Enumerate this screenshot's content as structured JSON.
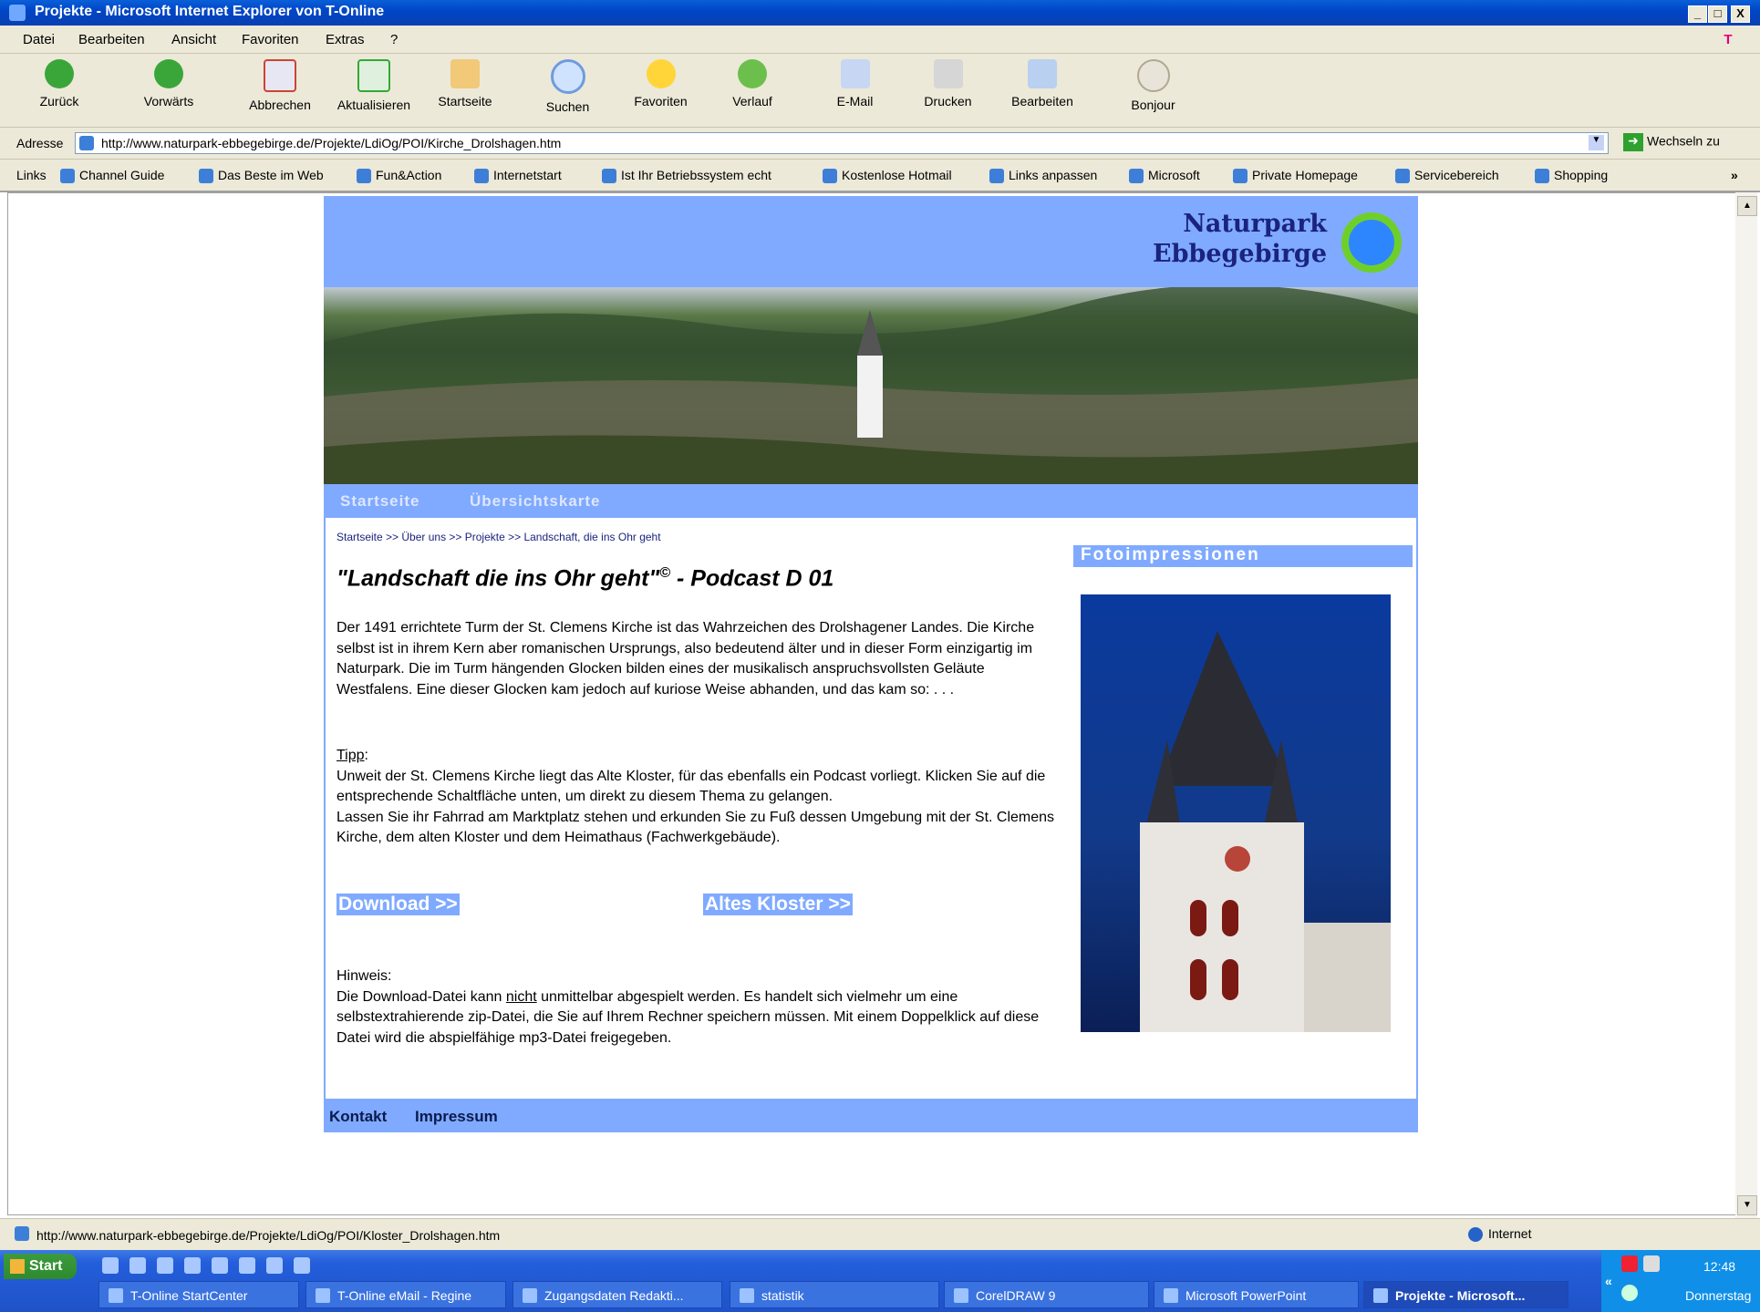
{
  "window": {
    "title": "Projekte - Microsoft Internet Explorer von T-Online",
    "minimize": "_",
    "maximize": "□",
    "close": "X"
  },
  "menu": [
    "Datei",
    "Bearbeiten",
    "Ansicht",
    "Favoriten",
    "Extras",
    "?"
  ],
  "brand_logo": "T",
  "toolbar": [
    {
      "label": "Zurück",
      "icon": "back-arrow-icon"
    },
    {
      "label": "Vorwärts",
      "icon": "forward-arrow-icon"
    },
    {
      "label": "Abbrechen",
      "icon": "stop-icon"
    },
    {
      "label": "Aktualisieren",
      "icon": "refresh-icon"
    },
    {
      "label": "Startseite",
      "icon": "home-icon"
    },
    {
      "label": "Suchen",
      "icon": "search-icon"
    },
    {
      "label": "Favoriten",
      "icon": "star-icon"
    },
    {
      "label": "Verlauf",
      "icon": "history-icon"
    },
    {
      "label": "E-Mail",
      "icon": "mail-icon"
    },
    {
      "label": "Drucken",
      "icon": "printer-icon"
    },
    {
      "label": "Bearbeiten",
      "icon": "edit-icon"
    },
    {
      "label": "Bonjour",
      "icon": "bonjour-icon"
    }
  ],
  "address": {
    "label": "Adresse",
    "url": "http://www.naturpark-ebbegebirge.de/Projekte/LdiOg/POI/Kirche_Drolshagen.htm",
    "go": "Wechseln zu"
  },
  "links": {
    "label": "Links",
    "items": [
      "Channel Guide",
      "Das Beste im Web",
      "Fun&Action",
      "Internetstart",
      "Ist Ihr Betriebssystem echt",
      "Kostenlose Hotmail",
      "Links anpassen",
      "Microsoft",
      "Private Homepage",
      "Servicebereich",
      "Shopping"
    ],
    "more": "»"
  },
  "page": {
    "logo_line1": "Naturpark",
    "logo_line2": "Ebbegebirge",
    "nav": [
      "Startseite",
      "Übersichtskarte"
    ],
    "breadcrumb": "Startseite >> Über uns >> Projekte >> Landschaft, die ins Ohr geht",
    "heading": "\"Landschaft die ins Ohr geht\"",
    "heading_sup": "©",
    "heading_rest": " -  Podcast D 01",
    "intro": "Der 1491 errichtete Turm der St. Clemens Kirche ist das Wahrzeichen des Drolshagener Landes. Die Kirche selbst ist in ihrem Kern aber romanischen Ursprungs, also bedeutend älter und in dieser Form einzigartig im Naturpark. Die im Turm hängenden Glocken bilden eines der musikalisch anspruchsvollsten Geläute Westfalens. Eine dieser Glocken kam jedoch auf kuriose Weise abhanden, und das kam so: . . .",
    "tipp_label": "Tipp",
    "tipp_colon": ":",
    "tipp_text1": "Unweit der St. Clemens Kirche liegt das Alte Kloster, für das ebenfalls ein Podcast vorliegt. Klicken Sie auf die entsprechende Schaltfläche unten, um direkt zu diesem Thema zu gelangen.",
    "tipp_text2": "Lassen Sie ihr Fahrrad am Marktplatz stehen und erkunden Sie zu Fuß dessen Umgebung mit der St. Clemens Kirche, dem alten Kloster und dem Heimathaus (Fachwerkgebäude).",
    "download_btn": "Download >>",
    "kloster_btn": "Altes Kloster >>",
    "hinweis_label": "Hinweis:",
    "hinweis_a": "Die Download-Datei kann ",
    "hinweis_nicht": "nicht",
    "hinweis_b": " unmittelbar abgespielt werden. Es handelt sich vielmehr um eine selbstextrahierende zip-Datei, die Sie auf Ihrem Rechner speichern müssen. Mit einem Doppelklick auf diese Datei wird die abspielfähige mp3-Datei freigegeben.",
    "sidebar_title": "Fotoimpressionen",
    "footer": [
      "Kontakt",
      "Impressum"
    ]
  },
  "status": {
    "url": "http://www.naturpark-ebbegebirge.de/Projekte/LdiOg/POI/Kloster_Drolshagen.htm",
    "zone": "Internet"
  },
  "taskbar": {
    "start": "Start",
    "tasks": [
      "T-Online StartCenter",
      "T-Online eMail - Regine",
      "Zugangsdaten Redakti...",
      "statistik",
      "CorelDRAW 9",
      "Microsoft PowerPoint",
      "Projekte - Microsoft..."
    ],
    "active_task": "Projekte - Microsoft...",
    "time": "12:48",
    "day": "Donnerstag",
    "expand": "«"
  },
  "colors": {
    "accent": "#80aaff",
    "logo_text": "#1a237e",
    "titlebar": "#0a5fd8"
  }
}
